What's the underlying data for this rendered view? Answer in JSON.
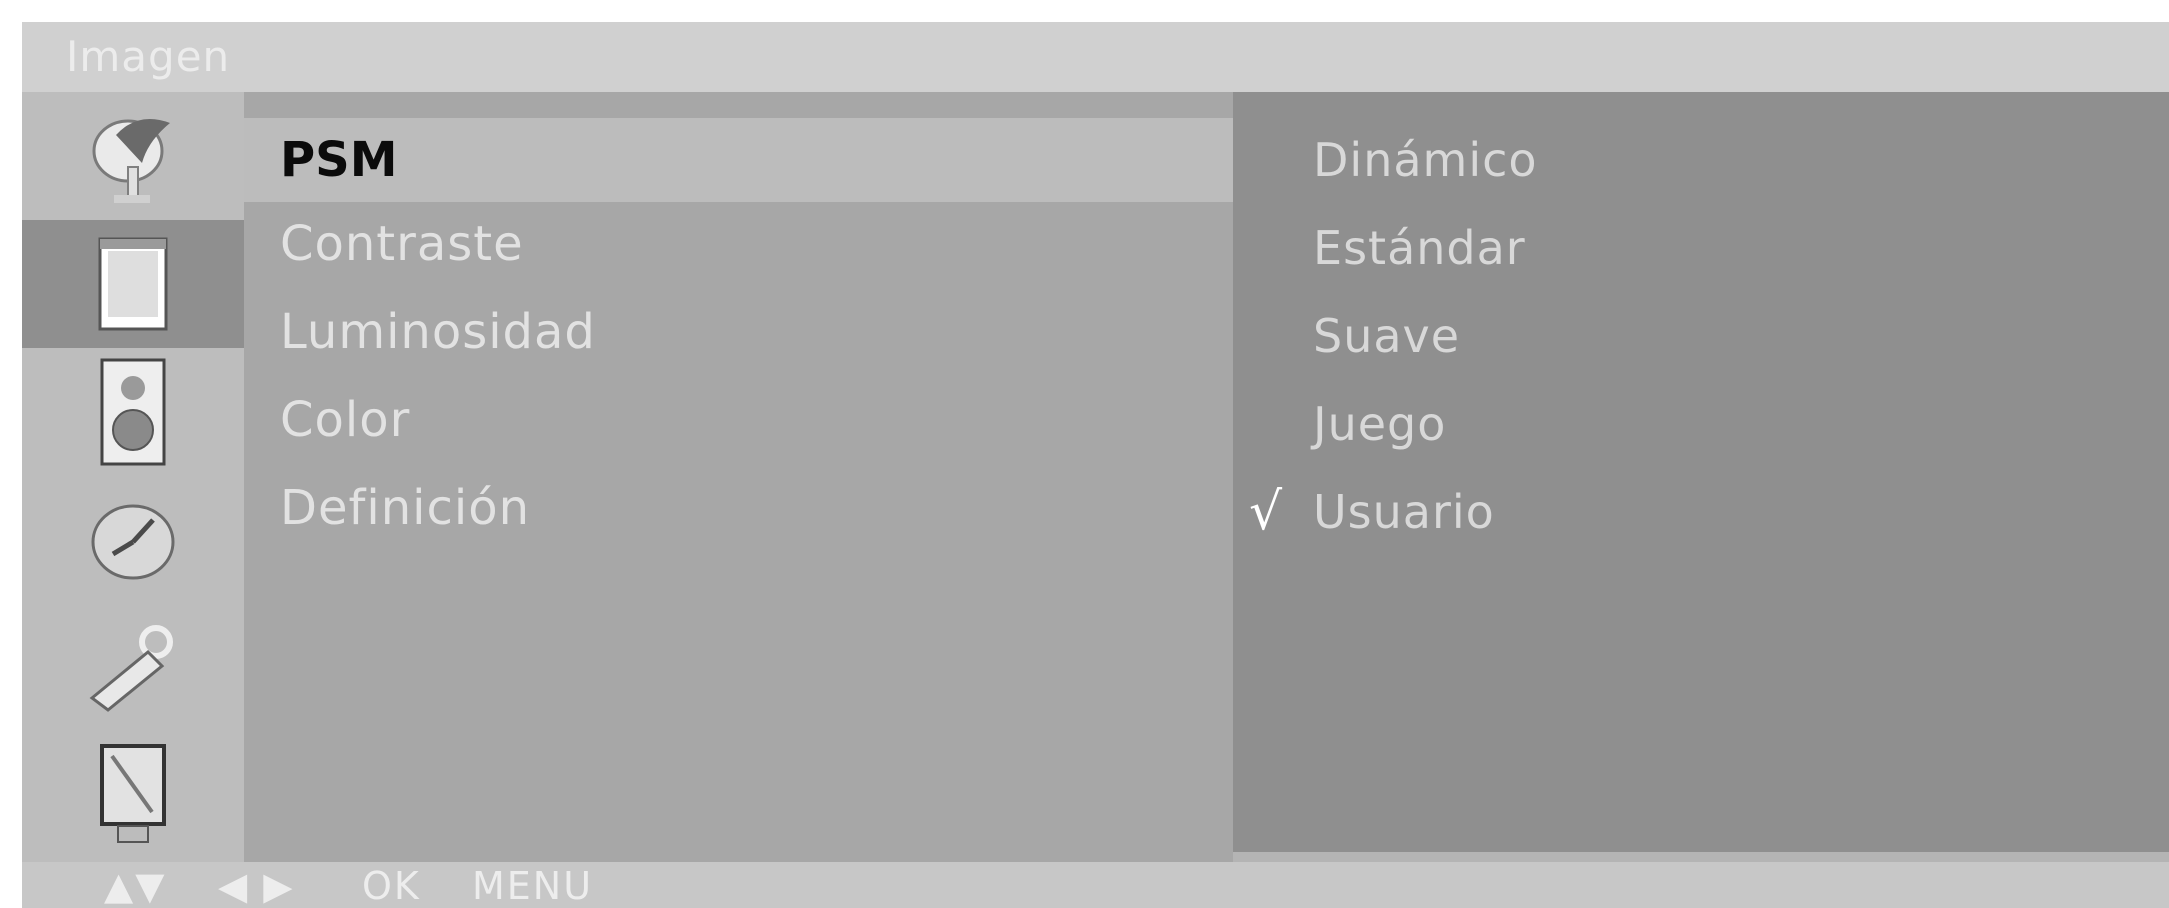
{
  "window": {
    "title": "Imagen"
  },
  "menu": {
    "items": [
      {
        "label": "PSM"
      },
      {
        "label": "Contraste"
      },
      {
        "label": "Luminosidad"
      },
      {
        "label": "Color"
      },
      {
        "label": "Definición"
      }
    ]
  },
  "options": {
    "items": [
      {
        "label": "Dinámico"
      },
      {
        "label": "Estándar"
      },
      {
        "label": "Suave"
      },
      {
        "label": "Juego"
      },
      {
        "label": "Usuario"
      }
    ],
    "checkmark": "√"
  },
  "icons": [
    {
      "name": "antenna-icon"
    },
    {
      "name": "picture-icon"
    },
    {
      "name": "speaker-icon"
    },
    {
      "name": "clock-icon"
    },
    {
      "name": "special-icon"
    },
    {
      "name": "screen-icon"
    }
  ],
  "footer": {
    "updown": "▲▼",
    "leftright": "◀ ▶",
    "ok": "OK",
    "menu": "MENU"
  }
}
